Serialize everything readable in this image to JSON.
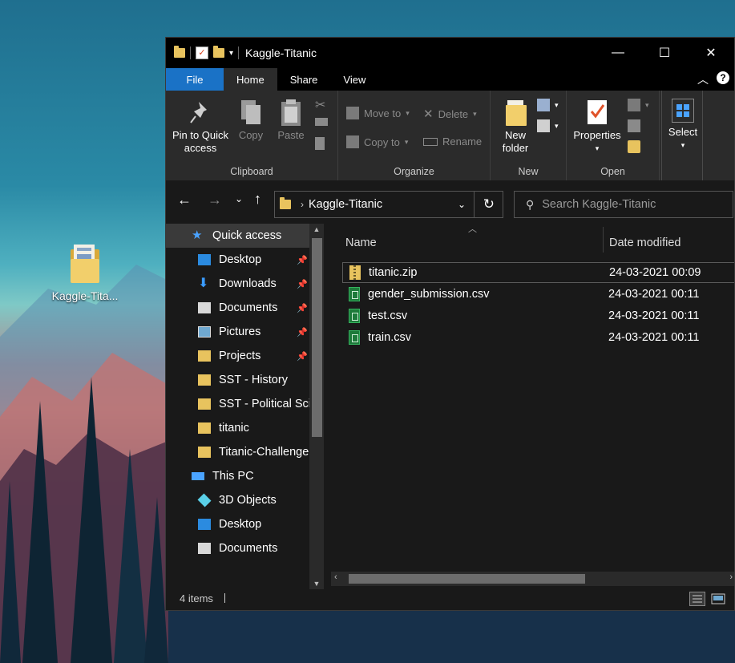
{
  "desktop": {
    "icon_label": "Kaggle-Tita..."
  },
  "window": {
    "title": "Kaggle-Titanic",
    "controls": {
      "minimize": "—",
      "maximize": "☐",
      "close": "✕"
    }
  },
  "ribbon": {
    "tabs": [
      "File",
      "Home",
      "Share",
      "View"
    ],
    "active_tab": "Home",
    "groups": {
      "clipboard": {
        "label": "Clipboard",
        "pin_label_1": "Pin to Quick",
        "pin_label_2": "access",
        "copy_label": "Copy",
        "paste_label": "Paste"
      },
      "organize": {
        "label": "Organize",
        "move_to": "Move to",
        "copy_to": "Copy to",
        "delete": "Delete",
        "rename": "Rename"
      },
      "new": {
        "label": "New",
        "new_folder_1": "New",
        "new_folder_2": "folder"
      },
      "open": {
        "label": "Open",
        "properties": "Properties"
      },
      "select": {
        "label": "Select"
      }
    }
  },
  "address": {
    "path": "Kaggle-Titanic",
    "search_placeholder": "Search Kaggle-Titanic"
  },
  "sidebar": {
    "items": [
      {
        "label": "Quick access",
        "icon": "star-icon"
      },
      {
        "label": "Desktop",
        "icon": "desktop-icon",
        "pinned": true
      },
      {
        "label": "Downloads",
        "icon": "download-icon",
        "pinned": true
      },
      {
        "label": "Documents",
        "icon": "documents-icon",
        "pinned": true
      },
      {
        "label": "Pictures",
        "icon": "pictures-icon",
        "pinned": true
      },
      {
        "label": "Projects",
        "icon": "folder-icon",
        "pinned": true
      },
      {
        "label": "SST - History",
        "icon": "folder-icon"
      },
      {
        "label": "SST - Political Sci",
        "icon": "folder-icon"
      },
      {
        "label": "titanic",
        "icon": "folder-icon"
      },
      {
        "label": "Titanic-Challenge",
        "icon": "folder-icon"
      },
      {
        "label": "This PC",
        "icon": "pc-icon"
      },
      {
        "label": "3D Objects",
        "icon": "3d-objects-icon"
      },
      {
        "label": "Desktop",
        "icon": "desktop-icon"
      },
      {
        "label": "Documents",
        "icon": "documents-icon"
      }
    ]
  },
  "content": {
    "columns": {
      "name": "Name",
      "date": "Date modified"
    },
    "files": [
      {
        "name": "titanic.zip",
        "date": "24-03-2021 00:09",
        "type": "zip"
      },
      {
        "name": "gender_submission.csv",
        "date": "24-03-2021 00:11",
        "type": "csv"
      },
      {
        "name": "test.csv",
        "date": "24-03-2021 00:11",
        "type": "csv"
      },
      {
        "name": "train.csv",
        "date": "24-03-2021 00:11",
        "type": "csv"
      }
    ]
  },
  "status": {
    "item_count": "4 items"
  },
  "colors": {
    "accent": "#1a72c6",
    "folder": "#e8c35e",
    "window_bg": "#191919"
  }
}
